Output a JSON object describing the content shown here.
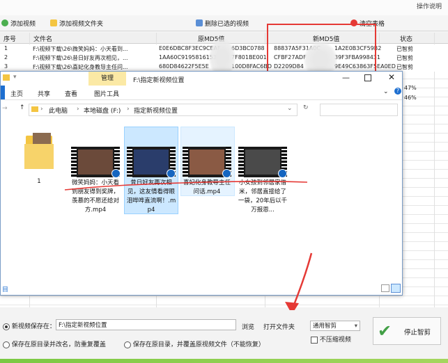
{
  "toolbar": {
    "add_video": "添加视频",
    "add_folder": "添加视频文件夹",
    "delete_selected": "删除已选的视频",
    "clear_table": "清空表格",
    "top_right_partial": "操作说明"
  },
  "table": {
    "headers": {
      "index": "序号",
      "filename": "文件名",
      "orig_md5": "原MD5值",
      "new_md5": "新MD5值",
      "status": "状态"
    },
    "rows": [
      {
        "index": "1",
        "filename": "F:\\视频下载\\26\\微笑妈妈：小天看到...",
        "orig_md5": "E0E6DBC8F3EC9CEAF",
        "orig_md5_tail": "6D3BC0788",
        "new_md5": "88837A5F31A0C",
        "new_md5_tail": "1A2E0B3CF59B2",
        "status": "已智剪"
      },
      {
        "index": "2",
        "filename": "F:\\视频下载\\26\\昔日好友再次相见，...",
        "orig_md5": "1AA60C9195816153",
        "orig_md5_tail": "7F801BE001",
        "new_md5": "CFBF27ADF",
        "new_md5_tail": "39F3FBA998431",
        "status": "已智剪"
      },
      {
        "index": "3",
        "filename": "F:\\视频下载\\26\\喜妃化身教导主任问...",
        "orig_md5": "680D84622F5E5E",
        "orig_md5_tail": "100D8FAC6BD",
        "new_md5": "D2209D84",
        "new_md5_tail": "9E49C63863F5EA0ED",
        "status": "已智剪"
      }
    ],
    "progress_rows": [
      {
        "percent_label": "47%"
      },
      {
        "percent_label": "46%"
      }
    ]
  },
  "explorer": {
    "manage_tab": "管理",
    "title_path": "F:\\指定新视频位置",
    "ribbon_tabs": [
      "主页",
      "共享",
      "查看",
      "图片工具"
    ],
    "breadcrumb": [
      "此电脑",
      "本地磁盘 (F:)",
      "指定新视频位置"
    ],
    "files": [
      {
        "name": "1",
        "kind": "folder"
      },
      {
        "name": "微笑妈妈：小天看到朋友得到奖牌，羡慕的不愿还给对方.mp4",
        "kind": "video",
        "thumb_color": "#6b4a3a"
      },
      {
        "name": "昔日好友再次相见，这友情看得眼泪哗哗直流啊！.mp4",
        "kind": "video",
        "thumb_color": "#2a3d6b"
      },
      {
        "name": "喜妃化身教导主任问话.mp4",
        "kind": "video",
        "thumb_color": "#8a5a44"
      },
      {
        "name": "小女孩到邻居家借米，邻居直接给了一袋，20年后以千万报恩...",
        "kind": "video",
        "thumb_color": "#4a4a4a"
      }
    ],
    "status_text": "目"
  },
  "bottom": {
    "save_new_label": "新视频保存在：",
    "save_path": "F:\\指定新视频位置",
    "browse": "浏览",
    "open_folder": "打开文件夹",
    "keep_dir_rename": "保存在原目录并改名，防重复覆盖",
    "keep_dir_overwrite": "保存在原目录，并覆盖原视频文件（不能恢复）",
    "mode_select": "通用智剪",
    "no_compress": "不压缩视频",
    "stop_button": "停止智剪"
  },
  "colors": {
    "highlight_box": "#e53935",
    "annotation_arrow": "#e53935",
    "accent_green": "#7ac943"
  }
}
